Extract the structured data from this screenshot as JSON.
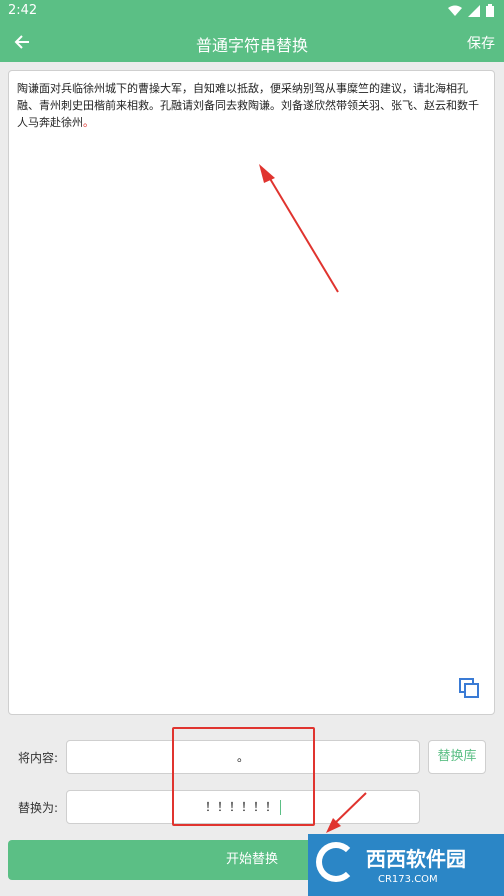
{
  "status_bar": {
    "time": "2:42"
  },
  "toolbar": {
    "title": "普通字符串替换",
    "save_label": "保存"
  },
  "editor": {
    "text_black": "陶谦面对兵临徐州城下的曹操大军，自知难以抵敌，便采纳别驾从事糜竺的建议，请北海相孔融、青州刺史田楷前来相救。孔融请刘备同去救陶谦。刘备遂欣然带领关羽、张飞、赵云和数千人马奔赴徐州",
    "text_red": "。"
  },
  "replace_row": {
    "label": "将内容:",
    "value": "。",
    "library_label": "替换库"
  },
  "with_row": {
    "label": "替换为:",
    "value": "！！！！！！"
  },
  "start_button": {
    "label": "开始替换"
  },
  "watermark": {
    "title": "西西软件园",
    "sub": "CR173.COM"
  },
  "colors": {
    "accent": "#5bbf85",
    "annotation": "#e0342f"
  },
  "icons": {
    "back": "arrow-left-icon",
    "copy": "copy-icon",
    "wifi": "wifi-icon",
    "signal": "signal-icon",
    "battery": "battery-icon"
  }
}
